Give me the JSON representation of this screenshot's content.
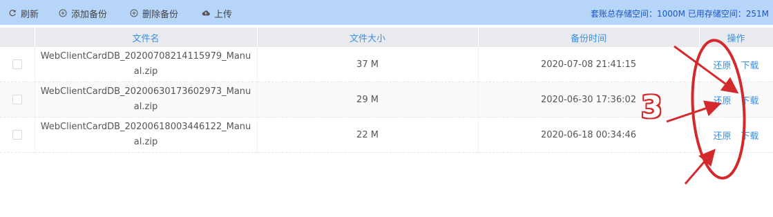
{
  "toolbar": {
    "refresh_label": "刷新",
    "add_backup_label": "添加备份",
    "delete_backup_label": "删除备份",
    "upload_label": "上传",
    "storage_info": "套账总存储空间：1000M 已用存储空间：251M"
  },
  "table": {
    "headers": {
      "filename": "文件名",
      "size": "文件大小",
      "time": "备份时间",
      "actions": "操作"
    },
    "rows": [
      {
        "name_line1": "WebClientCardDB_20200708214115979_Manu",
        "name_line2": "al.zip",
        "size": "37 M",
        "time": "2020-07-08 21:41:15",
        "restore": "还原",
        "download": "下载"
      },
      {
        "name_line1": "WebClientCardDB_20200630173602973_Manu",
        "name_line2": "al.zip",
        "size": "29 M",
        "time": "2020-06-30 17:36:02",
        "restore": "还原",
        "download": "下载"
      },
      {
        "name_line1": "WebClientCardDB_20200618003446122_Manu",
        "name_line2": "al.zip",
        "size": "22 M",
        "time": "2020-06-18 00:34:46",
        "restore": "还原",
        "download": "下载"
      }
    ]
  },
  "annotation": {
    "number": "3",
    "color": "#d3282c"
  },
  "colors": {
    "toolbar_bg": "#b7d5f8",
    "link": "#3a8ee6",
    "header_bg": "#e8eaee"
  },
  "icons": [
    "refresh-icon",
    "plus-circle-icon",
    "plus-circle-icon",
    "cloud-upload-icon"
  ]
}
